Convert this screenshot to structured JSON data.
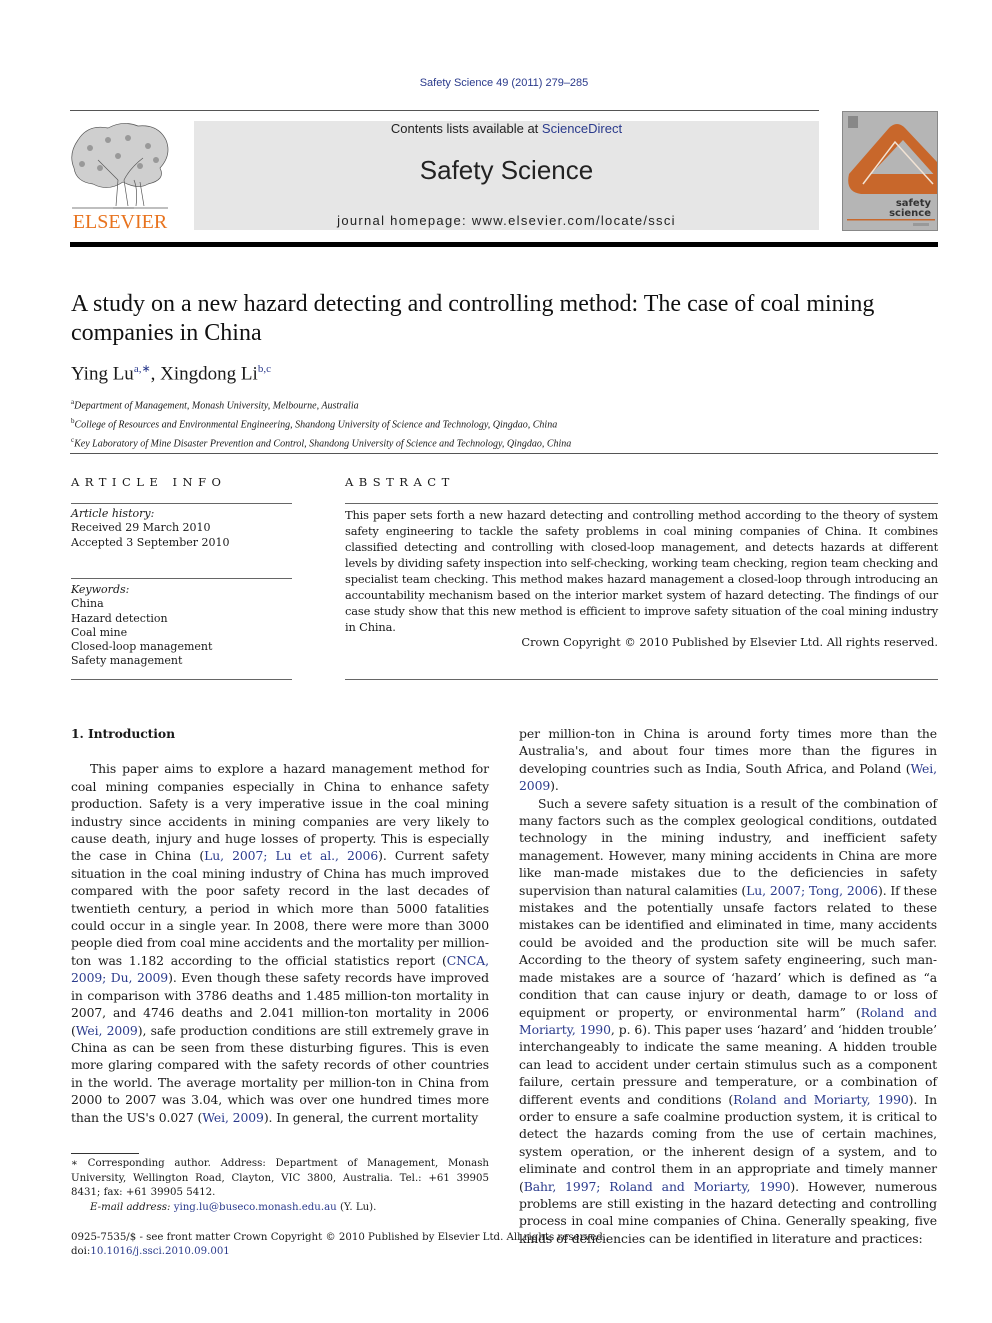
{
  "journal_ref": "Safety Science 49 (2011) 279–285",
  "header": {
    "publisher_logo_text": "ELSEVIER",
    "contents_prefix": "Contents lists available at ",
    "contents_link": "ScienceDirect",
    "journal_title": "Safety Science",
    "homepage": "journal homepage: www.elsevier.com/locate/ssci",
    "cover_title_line1": "safety",
    "cover_title_line2": "science",
    "colors": {
      "elsevier_orange": "#e8731e",
      "band_gray": "#e6e6e6",
      "link_blue": "#2a3a8c",
      "cover_orange": "#c8672b"
    }
  },
  "article": {
    "title": "A study on a new hazard detecting and controlling method: The case of coal mining companies in China",
    "authors": [
      {
        "name": "Ying Lu",
        "sup": "a,∗"
      },
      {
        "name": "Xingdong Li",
        "sup": "b,c"
      }
    ],
    "author_separator": ", ",
    "affiliations": [
      {
        "key": "a",
        "text": "Department of Management, Monash University, Melbourne, Australia"
      },
      {
        "key": "b",
        "text": "College of Resources and Environmental Engineering, Shandong University of Science and Technology, Qingdao, China"
      },
      {
        "key": "c",
        "text": "Key Laboratory of Mine Disaster Prevention and Control, Shandong University of Science and Technology, Qingdao, China"
      }
    ]
  },
  "article_info": {
    "heading": "ARTICLE INFO",
    "history_label": "Article history:",
    "received": "Received 29 March 2010",
    "accepted": "Accepted 3 September 2010",
    "keywords_label": "Keywords:",
    "keywords": [
      "China",
      "Hazard detection",
      "Coal mine",
      "Closed-loop management",
      "Safety management"
    ]
  },
  "abstract": {
    "heading": "ABSTRACT",
    "text": "This paper sets forth a new hazard detecting and controlling method according to the theory of system safety engineering to tackle the safety problems in coal mining companies of China. It combines classified detecting and controlling with closed-loop management, and detects hazards at different levels by dividing safety inspection into self-checking, working team checking, region team checking and specialist team checking. This method makes hazard management a closed-loop through introducing an accountability mechanism based on the interior market system of hazard detecting. The findings of our case study show that this new method is efficient to improve safety situation of the coal mining industry in China.",
    "copyright": "Crown Copyright © 2010 Published by Elsevier Ltd. All rights reserved."
  },
  "introduction": {
    "heading": "1. Introduction",
    "left_para": [
      {
        "t": "This paper aims to explore a hazard management method for coal mining companies especially in China to enhance safety production. Safety is a very imperative issue in the coal mining industry since accidents in mining companies are very likely to cause death, injury and huge losses of property. This is especially the case in China ("
      },
      {
        "link": "Lu, 2007; Lu et al., 2006"
      },
      {
        "t": "). Current safety situation in the coal mining industry of China has much improved compared with the poor safety record in the last decades of twentieth century, a period in which more than 5000 fatalities could occur in a single year. In 2008, there were more than 3000 people died from coal mine accidents and the mortality per million-ton was 1.182 according to the official statistics report ("
      },
      {
        "link": "CNCA, 2009; Du, 2009"
      },
      {
        "t": "). Even though these safety records have improved in comparison with 3786 deaths and 1.485 million-ton mortality in 2007, and 4746 deaths and 2.041 million-ton mortality in 2006 ("
      },
      {
        "link": "Wei, 2009"
      },
      {
        "t": "), safe production conditions are still extremely grave in China as can be seen from these disturbing figures. This is even more glaring compared with the safety records of other countries in the world. The average mortality per million-ton in China from 2000 to 2007 was 3.04, which was over one hundred times more than the US's 0.027 ("
      },
      {
        "link": "Wei, 2009"
      },
      {
        "t": "). In general, the current mortality"
      }
    ],
    "right_para1": [
      {
        "t": "per million-ton in China is around forty times more than the Australia's, and about four times more than the figures in developing countries such as India, South Africa, and Poland ("
      },
      {
        "link": "Wei, 2009"
      },
      {
        "t": ")."
      }
    ],
    "right_para2": [
      {
        "t": "Such a severe safety situation is a result of the combination of many factors such as the complex geological conditions, outdated technology in the mining industry, and inefficient safety management. However, many mining accidents in China are more like man-made mistakes due to the deficiencies in safety supervision than natural calamities ("
      },
      {
        "link": "Lu, 2007; Tong, 2006"
      },
      {
        "t": "). If these mistakes and the potentially unsafe factors related to these mistakes can be identified and eliminated in time, many accidents could be avoided and the production site will be much safer. According to the theory of system safety engineering, such man-made mistakes are a source of ‘hazard’ which is defined as “a condition that can cause injury or death, damage to or loss of equipment or property, or environmental harm” ("
      },
      {
        "link": "Roland and Moriarty, 1990"
      },
      {
        "t": ", p. 6). This paper uses ‘hazard’ and ‘hidden trouble’ interchangeably to indicate the same meaning. A hidden trouble can lead to accident under certain stimulus such as a component failure, certain pressure and temperature, or a combination of different events and conditions ("
      },
      {
        "link": "Roland and Moriarty, 1990"
      },
      {
        "t": "). In order to ensure a safe coalmine production system, it is critical to detect the hazards coming from the use of certain machines, system operation, or the inherent design of a system, and to eliminate and control them in an appropriate and timely manner ("
      },
      {
        "link": "Bahr, 1997; Roland and Moriarty, 1990"
      },
      {
        "t": "). However, numerous problems are still existing in the hazard detecting and controlling process in coal mine companies of China. Generally speaking, five kinds of deficiencies can be identified in literature and practices:"
      }
    ]
  },
  "footnote": {
    "star": "∗",
    "text": " Corresponding author. Address: Department of Management, Monash University, Wellington Road, Clayton, VIC 3800, Australia. Tel.: +61 39905 8431; fax: +61 39905 5412.",
    "email_label": "E-mail address: ",
    "email": "ying.lu@buseco.monash.edu.au",
    "email_suffix": " (Y. Lu)."
  },
  "bottom": {
    "issn_line": "0925-7535/$ - see front matter Crown Copyright © 2010 Published by Elsevier Ltd. All rights reserved.",
    "doi_prefix": "doi:",
    "doi": "10.1016/j.ssci.2010.09.001"
  }
}
